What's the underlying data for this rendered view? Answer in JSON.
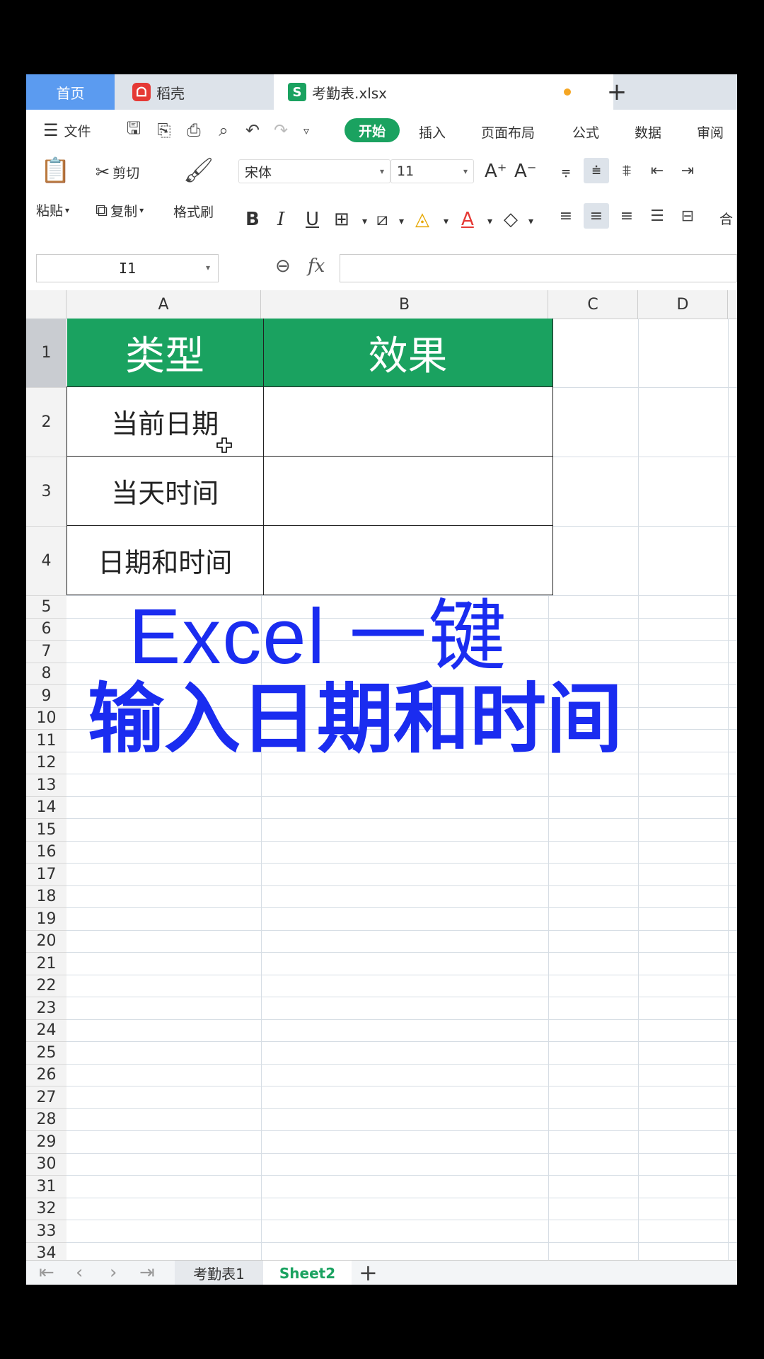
{
  "tabs": {
    "home": "首页",
    "daoke": "稻壳",
    "file": "考勤表.xlsx",
    "new_tab": "+"
  },
  "menu": {
    "file": "文件",
    "items": [
      "开始",
      "插入",
      "页面布局",
      "公式",
      "数据",
      "审阅"
    ]
  },
  "ribbon": {
    "paste": "粘贴",
    "cut": "剪切",
    "copy": "复制",
    "format_painter": "格式刷",
    "font_name": "宋体",
    "font_size": "11",
    "merge_partial": "合"
  },
  "formula_bar": {
    "name_box": "I1",
    "fx": "fx",
    "value": ""
  },
  "grid": {
    "columns": [
      "A",
      "B",
      "C",
      "D"
    ],
    "rows": [
      "1",
      "2",
      "3",
      "4",
      "5",
      "6",
      "7",
      "8",
      "9",
      "10",
      "11",
      "12",
      "13",
      "14",
      "15",
      "16",
      "17",
      "18",
      "19",
      "20",
      "21",
      "22",
      "23",
      "24",
      "25",
      "26",
      "27",
      "28",
      "29",
      "30",
      "31",
      "32",
      "33",
      "34"
    ]
  },
  "table": {
    "headers": [
      "类型",
      "效果"
    ],
    "rows": [
      [
        "当前日期",
        ""
      ],
      [
        "当天时间",
        ""
      ],
      [
        "日期和时间",
        ""
      ]
    ]
  },
  "overlay": {
    "line1": "Excel 一键",
    "line2": "输入日期和时间"
  },
  "sheets": {
    "tabs": [
      "考勤表1",
      "Sheet2"
    ],
    "add": "+"
  },
  "colors": {
    "accent": "#1aa260",
    "overlay_text": "#1a2cf0",
    "home_tab": "#5b9bf0"
  }
}
